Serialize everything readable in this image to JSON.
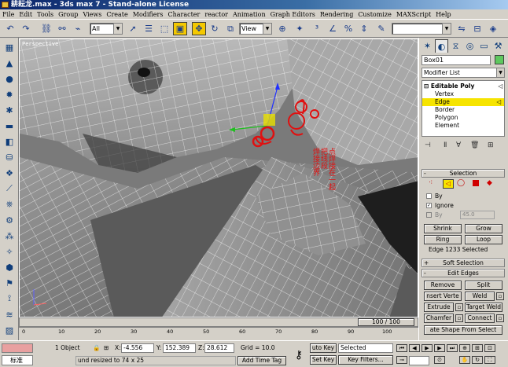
{
  "window": {
    "title": "耕耘龙.max - 3ds max 7 - Stand-alone License"
  },
  "menu": [
    "File",
    "Edit",
    "Tools",
    "Group",
    "Views",
    "Create",
    "Modifiers",
    "Character",
    "reactor",
    "Animation",
    "Graph Editors",
    "Rendering",
    "Customize",
    "MAXScript",
    "Help"
  ],
  "toolbar": {
    "selection_filter": "All",
    "coord_system": "View"
  },
  "viewport": {
    "label": "Perspective",
    "annotation_lines": [
      "焊接边界",
      "把线段",
      "点焊接在一起"
    ]
  },
  "command_panel": {
    "object_name": "Box01",
    "object_color": "#5ec85e",
    "modifier_list": "Modifier List",
    "stack_root": "Editable Poly",
    "stack_items": [
      "Vertex",
      "Edge",
      "Border",
      "Polygon",
      "Element"
    ],
    "selected_subobject": "Edge",
    "selection_rollout": {
      "title": "Selection",
      "by_label": "By",
      "ignore_label": "Ignore",
      "by_angle_label": "By",
      "angle_value": "45.0",
      "shrink": "Shrink",
      "grow": "Grow",
      "ring": "Ring",
      "loop": "Loop",
      "status": "Edge 1233 Selected"
    },
    "soft_selection_title": "Soft Selection",
    "edit_edges": {
      "title": "Edit Edges",
      "remove": "Remove",
      "split": "Split",
      "insert_vertex": "nsert Verte",
      "weld": "Weld",
      "extrude": "Extrude",
      "target_weld": "Target Weld",
      "chamfer": "Chamfer",
      "connect": "Connect",
      "create_shape": "ate Shape From Select"
    }
  },
  "time_slider": {
    "frame": "100 / 100"
  },
  "track_labels": [
    "0",
    "10",
    "20",
    "30",
    "40",
    "50",
    "60",
    "70",
    "80",
    "90",
    "100"
  ],
  "status": {
    "object_count": "1 Object",
    "x_label": "X:",
    "x_value": "-4.556",
    "y_label": "Y:",
    "y_value": "152.389",
    "z_label": "Z:",
    "z_value": "28.612",
    "grid": "Grid = 10.0",
    "auto_key": "uto Key",
    "selected": "Selected",
    "set_key": "Set Key",
    "key_filters": "Key Filters...",
    "maxscript_label": "标准",
    "prompt": "und resized to 74 x 25",
    "add_time_tag": "Add Time Tag"
  }
}
